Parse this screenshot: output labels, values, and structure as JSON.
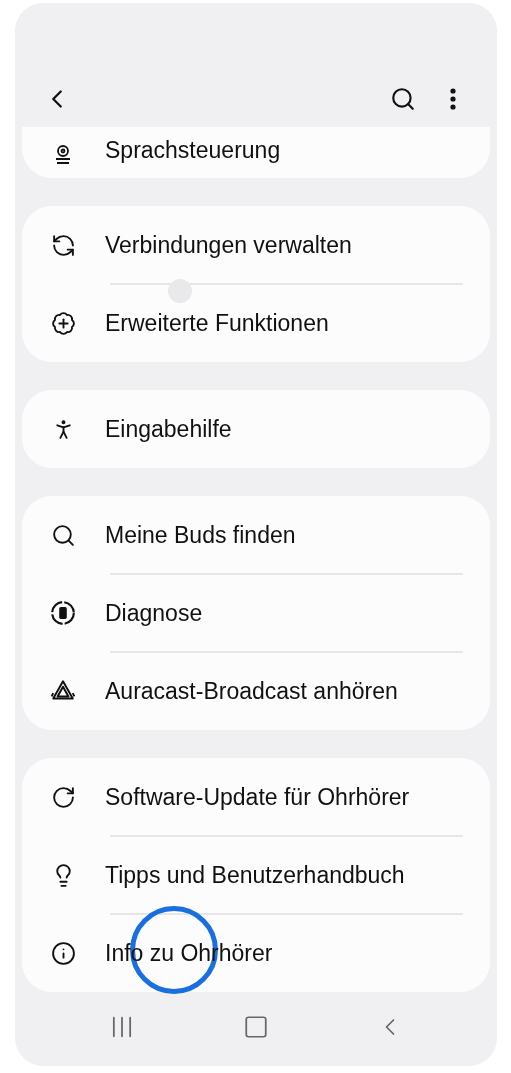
{
  "groups": [
    {
      "items": [
        {
          "label": "Sprachsteuerung"
        }
      ]
    },
    {
      "items": [
        {
          "label": "Verbindungen verwalten"
        },
        {
          "label": "Erweiterte Funktionen"
        }
      ]
    },
    {
      "items": [
        {
          "label": "Eingabehilfe"
        }
      ]
    },
    {
      "items": [
        {
          "label": "Meine Buds finden"
        },
        {
          "label": "Diagnose"
        },
        {
          "label": "Auracast-Broadcast anhören"
        }
      ]
    },
    {
      "items": [
        {
          "label": "Software-Update für Ohrhörer"
        },
        {
          "label": "Tipps und Benutzerhandbuch"
        },
        {
          "label": "Info zu Ohrhörer"
        }
      ]
    }
  ],
  "touch_indicators": [
    {
      "kind": "dot"
    },
    {
      "kind": "ring"
    }
  ]
}
